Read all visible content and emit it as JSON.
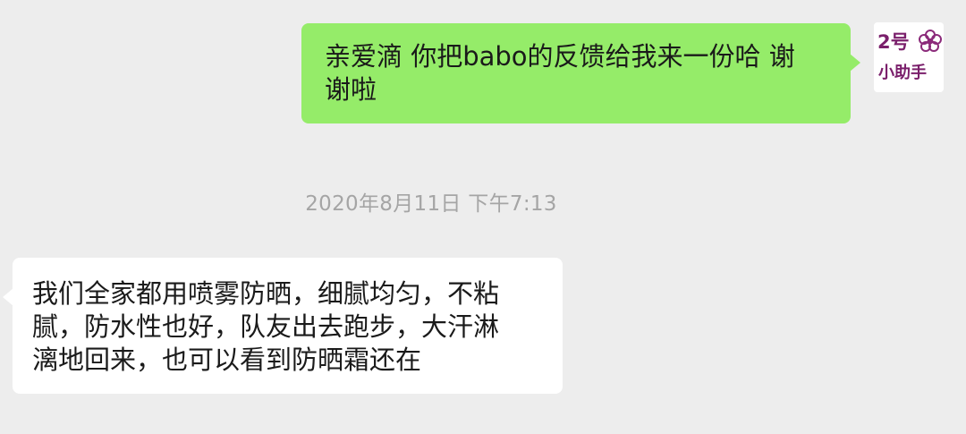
{
  "messages": [
    {
      "direction": "outgoing",
      "lines": [
        "亲爱滴 你把babo的反馈给我来一份哈 谢",
        "谢啦"
      ]
    },
    {
      "direction": "incoming",
      "lines": [
        "我们全家都用喷雾防晒，细腻均匀，不粘",
        "腻，防水性也好，队友出去跑步，大汗淋",
        "漓地回来，也可以看到防晒霜还在"
      ]
    }
  ],
  "timestamp": "2020年8月11日 下午7:13",
  "avatar": {
    "line1": "2号",
    "line2": "小助手",
    "icon": "flower-icon"
  },
  "colors": {
    "background": "#ededed",
    "outgoing_bubble": "#95ec69",
    "incoming_bubble": "#ffffff",
    "timestamp_text": "#a5a5a5",
    "avatar_text": "#7a1f6b"
  }
}
